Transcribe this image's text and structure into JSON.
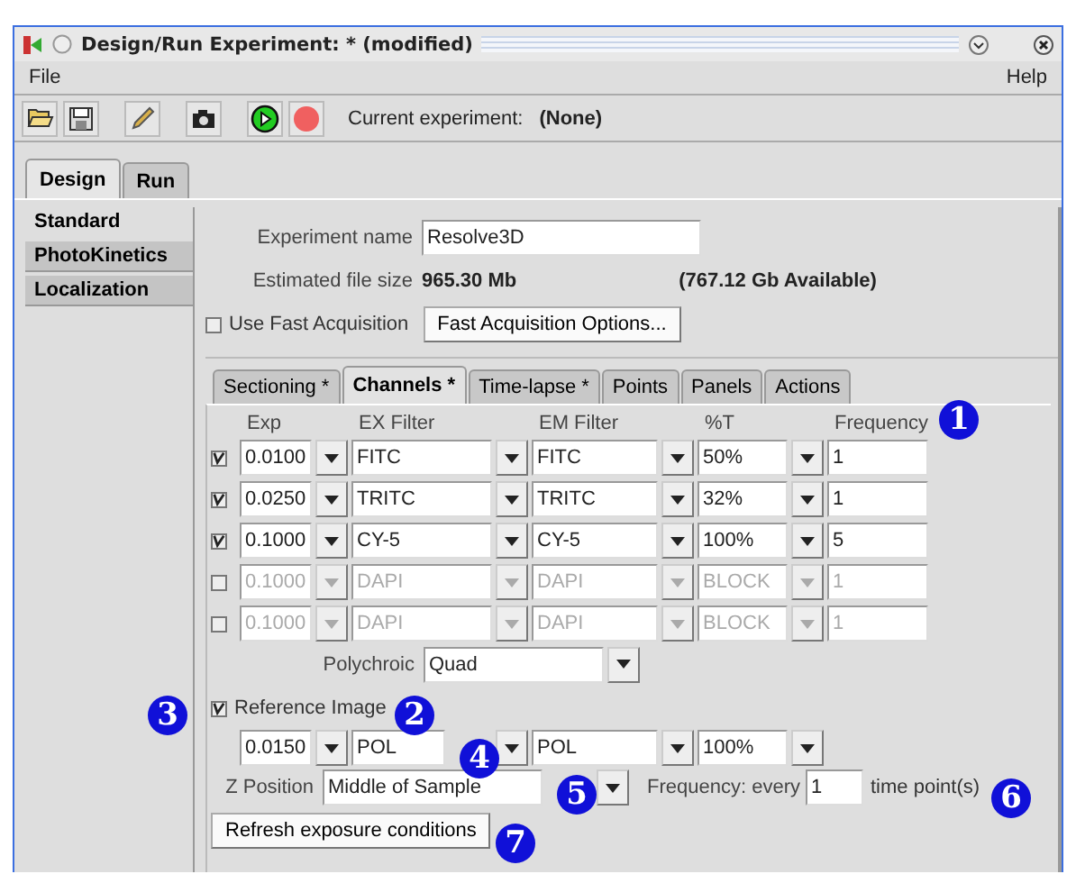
{
  "window": {
    "title": "Design/Run Experiment:  * (modified)"
  },
  "menu": [
    {
      "label": "File"
    },
    {
      "label": "Help"
    }
  ],
  "toolbar": {
    "label": "Current experiment:",
    "value": "(None)"
  },
  "main_tabs": [
    {
      "label": "Design",
      "selected": true
    },
    {
      "label": "Run",
      "selected": false
    }
  ],
  "sidebar": [
    {
      "label": "Standard",
      "selected": true
    },
    {
      "label": "PhotoKinetics",
      "selected": false
    },
    {
      "label": "Localization",
      "selected": false
    }
  ],
  "experiment_name": {
    "label": "Experiment name",
    "value": "Resolve3D"
  },
  "file_size": {
    "label": "Estimated file size",
    "value": "965.30 Mb",
    "available": "(767.12 Gb Available)"
  },
  "fast_acquisition": {
    "label": "Use Fast Acquisition",
    "checked": false,
    "button": "Fast Acquisition Options..."
  },
  "sub_tabs": [
    {
      "label": "Sectioning *",
      "selected": false
    },
    {
      "label": "Channels *",
      "selected": true
    },
    {
      "label": "Time-lapse *",
      "selected": false
    },
    {
      "label": "Points",
      "selected": false
    },
    {
      "label": "Panels",
      "selected": false
    },
    {
      "label": "Actions",
      "selected": false
    }
  ],
  "channels": {
    "columns": [
      "Exp",
      "EX Filter",
      "EM Filter",
      "%T",
      "Frequency"
    ],
    "rows": [
      {
        "checked": true,
        "exp": "0.0100",
        "ex": "FITC",
        "em": "FITC",
        "t": "50%",
        "frequency": "1"
      },
      {
        "checked": true,
        "exp": "0.0250",
        "ex": "TRITC",
        "em": "TRITC",
        "t": "32%",
        "frequency": "1"
      },
      {
        "checked": true,
        "exp": "0.1000",
        "ex": "CY-5",
        "em": "CY-5",
        "t": "100%",
        "frequency": "5"
      },
      {
        "checked": false,
        "exp": "0.1000",
        "ex": "DAPI",
        "em": "DAPI",
        "t": "BLOCK",
        "frequency": "1"
      },
      {
        "checked": false,
        "exp": "0.1000",
        "ex": "DAPI",
        "em": "DAPI",
        "t": "BLOCK",
        "frequency": "1"
      }
    ]
  },
  "polychroic": {
    "label": "Polychroic",
    "value": "Quad"
  },
  "reference_image": {
    "label": "Reference Image",
    "checked": true,
    "exp": "0.0150",
    "ex": "POL",
    "em": "POL",
    "t": "100%"
  },
  "z_position": {
    "label": "Z Position",
    "value": "Middle of Sample",
    "frequency_label": "Frequency: every",
    "frequency": "1",
    "unit": "time point(s)"
  },
  "refresh_button": "Refresh exposure conditions",
  "callouts": [
    "1",
    "2",
    "3",
    "4",
    "5",
    "6",
    "7"
  ]
}
